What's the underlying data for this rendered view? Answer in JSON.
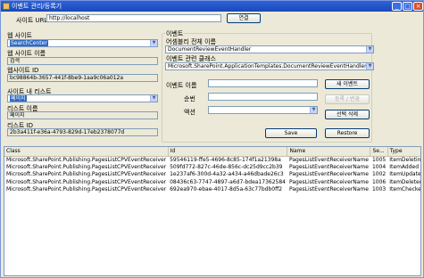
{
  "window": {
    "title": "이벤트 관리/등록기"
  },
  "connect": {
    "url_label": "사이트 URL",
    "url_value": "http://localhost",
    "connect_button": "연결"
  },
  "web": {
    "group_label": "웹 사이트",
    "selected": "SearchCenter",
    "name_label": "웹 사이트 이름",
    "name_value": "검색",
    "id_label": "웹사이트 ID",
    "id_value": "bc98864b-3657-441f-8be9-1aa9c06a012a"
  },
  "list": {
    "group_label": "사이트 내 리스트",
    "selected": "페이지",
    "name_label": "리스트 이름",
    "name_value": "페이지",
    "id_label": "리스트 ID",
    "id_value": "2b3a411f-e36a-4793-829d-17eb2378077d"
  },
  "event": {
    "group_label": "이벤트",
    "assembly_label": "어셈블리 전체 이름",
    "assembly_value": "DocumentReviewEventHandler",
    "class_label": "이벤트 관련 클래스",
    "class_value": "Microsoft.SharePoint.ApplicationTemplates.DocumentReviewEventHandler",
    "name_label": "이벤트 이름",
    "name_value": "",
    "order_label": "순번",
    "order_value": "",
    "action_label": "액션",
    "action_value": "",
    "new_button": "새 이벤트",
    "register_button": "등록 / 변경",
    "delete_button": "선택 삭제",
    "save_button": "Save",
    "restore_button": "Restore"
  },
  "grid": {
    "columns": [
      "Class",
      "Id",
      "Name",
      "Se...",
      "Type"
    ],
    "rows": [
      [
        "Microsoft.SharePoint.Publishing.PagesListCPVEventReceiver",
        "59546119-ffe5-4696-8c85-174f1a21398a",
        "PagesListEventReceiverName",
        "1005",
        "ItemDeleting"
      ],
      [
        "Microsoft.SharePoint.Publishing.PagesListCPVEventReceiver",
        "509fd772-827c-46de-856c-dc25d9cc2b39",
        "PagesListEventReceiverName",
        "1004",
        "ItemAdded"
      ],
      [
        "Microsoft.SharePoint.Publishing.PagesListCPVEventReceiver",
        "1e237af6-300d-4a32-a434-a46dbade26c3",
        "PagesListEventReceiverName",
        "1002",
        "ItemUpdated"
      ],
      [
        "Microsoft.SharePoint.Publishing.PagesListCPVEventReceiver",
        "08436c63-7747-4897-a6d7-bdea17362584",
        "PagesListEventReceiverName",
        "1006",
        "ItemDeleted"
      ],
      [
        "Microsoft.SharePoint.Publishing.PagesListCPVEventReceiver",
        "692ea970-ebae-4017-8d5a-63c77bdb0ff2",
        "PagesListEventReceiverName",
        "1003",
        "ItemCheckedIn"
      ]
    ]
  }
}
